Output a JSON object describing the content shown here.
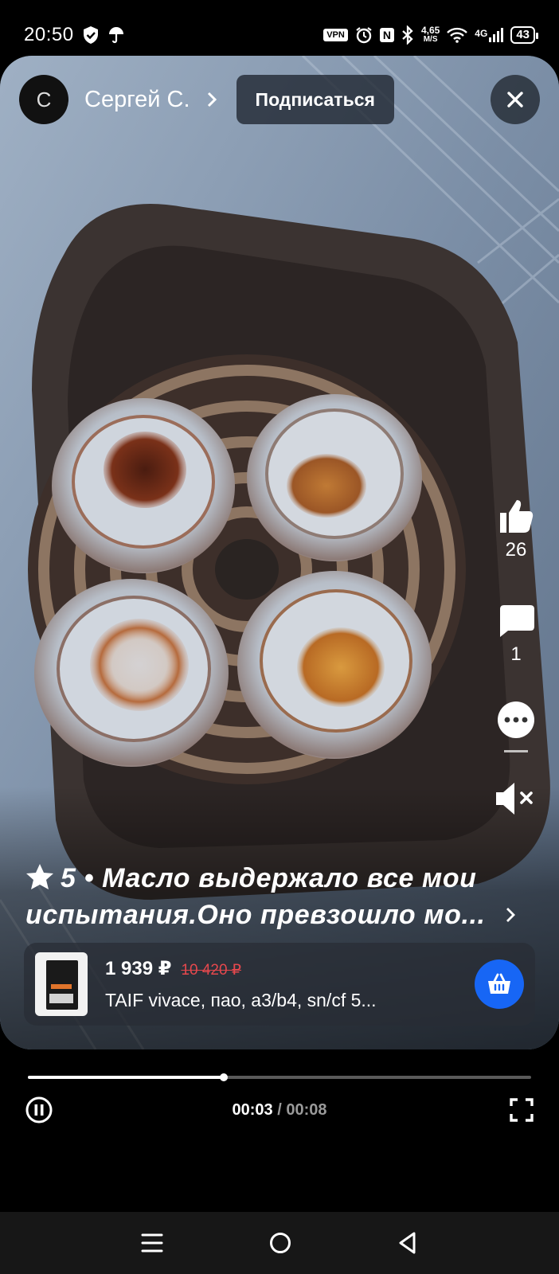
{
  "status_bar": {
    "time": "20:50",
    "vpn": "VPN",
    "nfc": "N",
    "speed_value": "4,65",
    "speed_unit": "M/S",
    "network": "4G",
    "battery": "43"
  },
  "header": {
    "avatar_letter": "С",
    "author": "Сергей С.",
    "subscribe_label": "Подписаться"
  },
  "actions": {
    "likes": "26",
    "comments": "1"
  },
  "caption": {
    "rating": "5",
    "separator": "•",
    "line1": "Масло выдержало все мои",
    "line2": "испытания.Оно превзошло мо..."
  },
  "product": {
    "price": "1 939 ₽",
    "old_price": "10 420 ₽",
    "name": "TAIF  vivace, пао, а3/b4, sn/cf  5..."
  },
  "player": {
    "progress": 0.39,
    "current_time": "00:03",
    "separator": "/",
    "duration": "00:08"
  },
  "colors": {
    "accent": "#1766f5",
    "old_price": "#e5484d",
    "nav_bg": "#171717"
  }
}
